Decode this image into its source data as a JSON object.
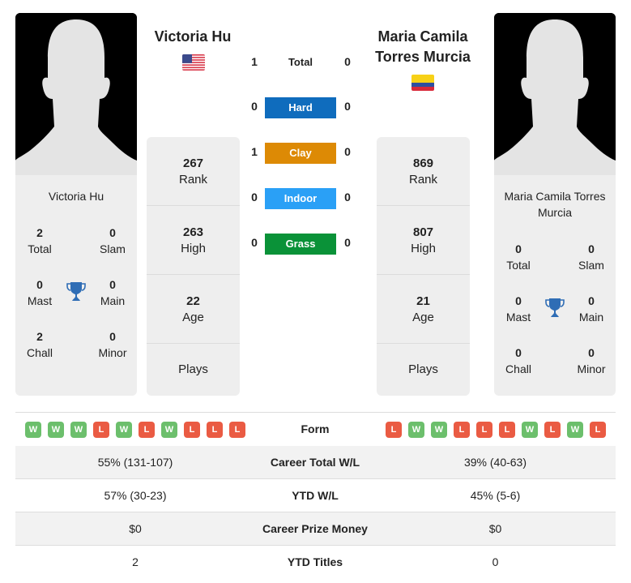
{
  "colors": {
    "hard": "#0f6cbd",
    "clay": "#dd8a05",
    "indoor": "#2aa0f6",
    "grass": "#0a9238",
    "win": "#6cbf6c",
    "loss": "#ea5b43",
    "trophy": "#2f6db5"
  },
  "player1": {
    "name": "Victoria Hu",
    "flag_icon": "usa-flag-icon",
    "card_name": "Victoria Hu",
    "titles": {
      "total": {
        "value": "2",
        "label": "Total"
      },
      "slam": {
        "value": "0",
        "label": "Slam"
      },
      "mast": {
        "value": "0",
        "label": "Mast"
      },
      "main": {
        "value": "0",
        "label": "Main"
      },
      "chall": {
        "value": "2",
        "label": "Chall"
      },
      "minor": {
        "value": "0",
        "label": "Minor"
      }
    },
    "stats": {
      "rank": {
        "value": "267",
        "label": "Rank"
      },
      "high": {
        "value": "263",
        "label": "High"
      },
      "age": {
        "value": "22",
        "label": "Age"
      },
      "plays": {
        "value": "",
        "label": "Plays"
      }
    },
    "form": [
      "W",
      "W",
      "W",
      "L",
      "W",
      "L",
      "W",
      "L",
      "L",
      "L"
    ]
  },
  "player2": {
    "name_line1": "Maria Camila",
    "name_line2": "Torres Murcia",
    "flag_icon": "colombia-flag-icon",
    "card_name_line1": "Maria Camila Torres",
    "card_name_line2": "Murcia",
    "titles": {
      "total": {
        "value": "0",
        "label": "Total"
      },
      "slam": {
        "value": "0",
        "label": "Slam"
      },
      "mast": {
        "value": "0",
        "label": "Mast"
      },
      "main": {
        "value": "0",
        "label": "Main"
      },
      "chall": {
        "value": "0",
        "label": "Chall"
      },
      "minor": {
        "value": "0",
        "label": "Minor"
      }
    },
    "stats": {
      "rank": {
        "value": "869",
        "label": "Rank"
      },
      "high": {
        "value": "807",
        "label": "High"
      },
      "age": {
        "value": "21",
        "label": "Age"
      },
      "plays": {
        "value": "",
        "label": "Plays"
      }
    },
    "form": [
      "L",
      "W",
      "W",
      "L",
      "L",
      "L",
      "W",
      "L",
      "W",
      "L"
    ]
  },
  "h2h": {
    "total": {
      "label": "Total",
      "p1": "1",
      "p2": "0"
    },
    "surfaces": [
      {
        "label": "Hard",
        "p1": "0",
        "p2": "0"
      },
      {
        "label": "Clay",
        "p1": "1",
        "p2": "0"
      },
      {
        "label": "Indoor",
        "p1": "0",
        "p2": "0"
      },
      {
        "label": "Grass",
        "p1": "0",
        "p2": "0"
      }
    ]
  },
  "comparison": {
    "form_label": "Form",
    "rows": [
      {
        "label": "Career Total W/L",
        "p1": "55% (131-107)",
        "p2": "39% (40-63)"
      },
      {
        "label": "YTD W/L",
        "p1": "57% (30-23)",
        "p2": "45% (5-6)"
      },
      {
        "label": "Career Prize Money",
        "p1": "$0",
        "p2": "$0"
      },
      {
        "label": "YTD Titles",
        "p1": "2",
        "p2": "0"
      }
    ]
  }
}
